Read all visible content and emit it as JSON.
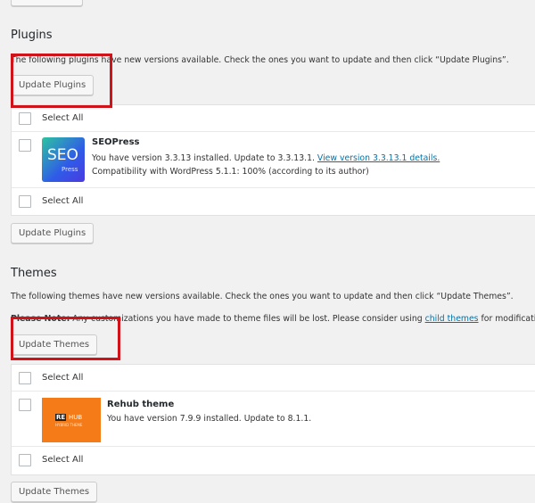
{
  "top_button_label": "",
  "plugins": {
    "heading": "Plugins",
    "description": "The following plugins have new versions available. Check the ones you want to update and then click “Update Plugins”.",
    "update_button": "Update Plugins",
    "select_all": "Select All",
    "items": [
      {
        "name": "SEOPress",
        "logo_text": "SEO",
        "logo_sub": "Press",
        "version_text": "You have version 3.3.13 installed. Update to 3.3.13.1.",
        "details_link": "View version 3.3.13.1 details.",
        "compat": "Compatibility with WordPress 5.1.1: 100% (according to its author)"
      }
    ]
  },
  "themes": {
    "heading": "Themes",
    "description": "The following themes have new versions available. Check the ones you want to update and then click “Update Themes”.",
    "note_label": "Please Note:",
    "note_text": "Any customizations you have made to theme files will be lost. Please consider using",
    "child_themes_link": "child themes",
    "note_suffix": "for modifications.",
    "update_button": "Update Themes",
    "select_all": "Select All",
    "items": [
      {
        "name": "Rehub theme",
        "logo_re": "RE",
        "logo_hub": "HUB",
        "logo_sub": "HYBRID THEME",
        "version_text": "You have version 7.9.9 installed. Update to 8.1.1."
      }
    ]
  },
  "colors": {
    "highlight": "#d0121b",
    "link": "#0073aa",
    "rehub_bg": "#f57b18"
  }
}
